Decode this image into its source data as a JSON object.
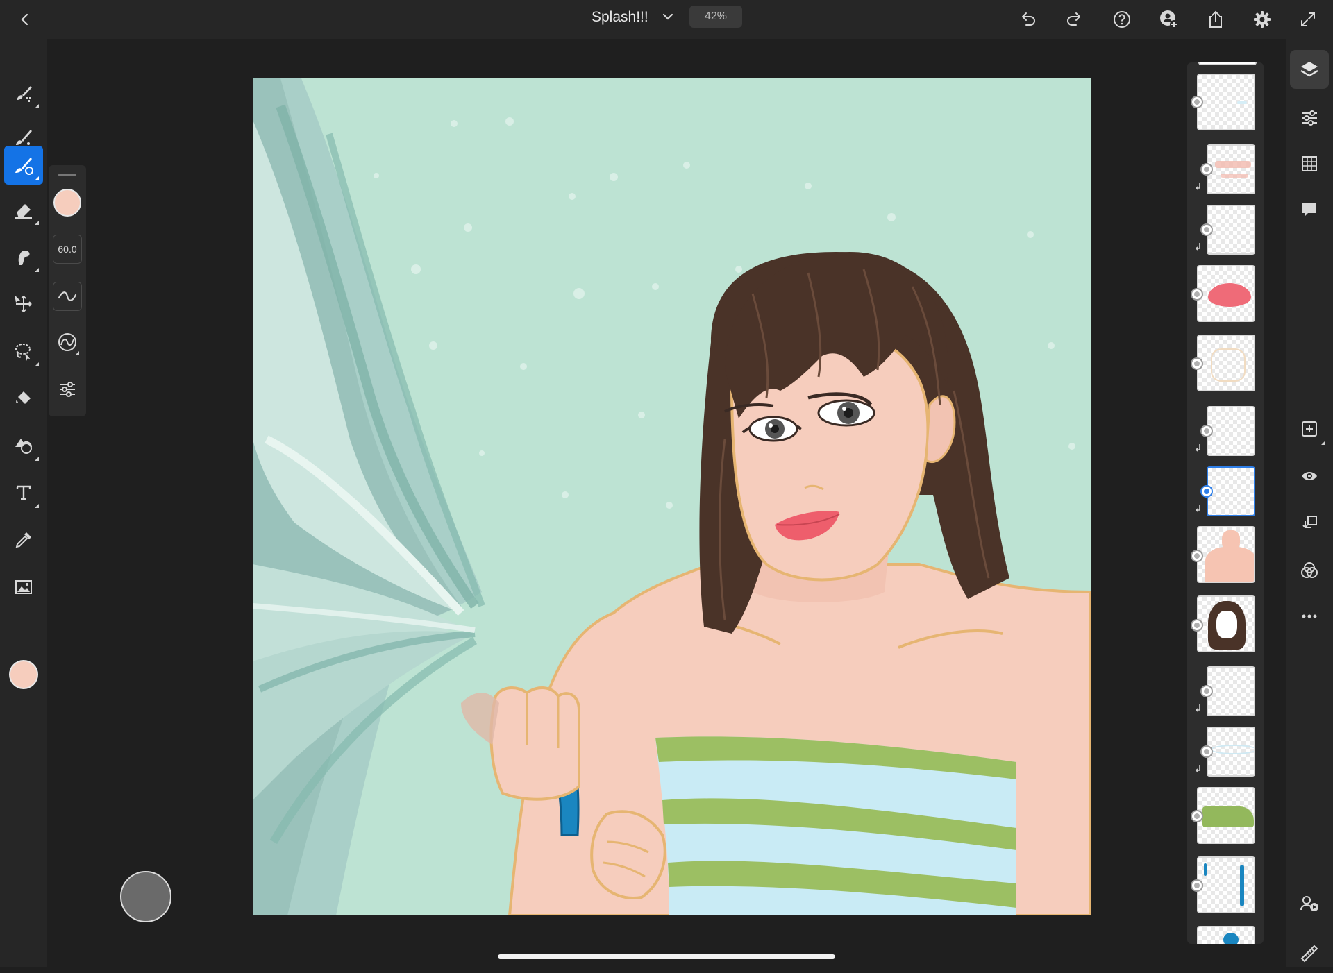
{
  "app": {
    "doc_title": "Splash!!!",
    "zoom": "42%"
  },
  "brush_panel": {
    "size": "60.0",
    "color": "#f6cdbd"
  },
  "left_tools": [
    {
      "name": "pixel-brush",
      "icon": "pixel-brush-icon"
    },
    {
      "name": "live-brush",
      "icon": "live-brush-icon"
    },
    {
      "name": "vector-brush",
      "icon": "vector-brush-icon",
      "active": true
    },
    {
      "name": "eraser",
      "icon": "eraser-icon"
    },
    {
      "name": "smudge",
      "icon": "smudge-icon"
    },
    {
      "name": "transform",
      "icon": "move-icon"
    },
    {
      "name": "selection",
      "icon": "lasso-icon"
    },
    {
      "name": "fill",
      "icon": "paint-bucket-icon"
    },
    {
      "name": "shapes",
      "icon": "shapes-icon"
    },
    {
      "name": "text",
      "icon": "text-icon"
    },
    {
      "name": "eyedropper",
      "icon": "eyedropper-icon"
    },
    {
      "name": "place-image",
      "icon": "image-icon"
    }
  ],
  "right_tools": [
    {
      "name": "layers",
      "icon": "layers-icon",
      "active": true
    },
    {
      "name": "layer-properties",
      "icon": "sliders-icon"
    },
    {
      "name": "grid",
      "icon": "grid-icon"
    },
    {
      "name": "comments",
      "icon": "comment-icon"
    },
    {
      "name": "add-layer",
      "icon": "add-layer-icon"
    },
    {
      "name": "visibility",
      "icon": "eye-icon"
    },
    {
      "name": "clipping-mask",
      "icon": "clip-icon"
    },
    {
      "name": "blend-mode",
      "icon": "blend-icon"
    },
    {
      "name": "more",
      "icon": "more-icon"
    },
    {
      "name": "collaborate",
      "icon": "collaborate-icon"
    },
    {
      "name": "ruler",
      "icon": "ruler-icon"
    }
  ],
  "layers": [
    {
      "content": "blue streak",
      "clipped": false
    },
    {
      "content": "pink blush",
      "clipped": true
    },
    {
      "content": "empty",
      "clipped": true
    },
    {
      "content": "pink lips",
      "clipped": false
    },
    {
      "content": "face outline",
      "clipped": false
    },
    {
      "content": "empty",
      "clipped": true
    },
    {
      "content": "empty",
      "clipped": true,
      "selected": true
    },
    {
      "content": "skin body",
      "clipped": false
    },
    {
      "content": "brown hair",
      "clipped": false
    },
    {
      "content": "empty",
      "clipped": true
    },
    {
      "content": "light blue stripe",
      "clipped": true
    },
    {
      "content": "green towel",
      "clipped": false
    },
    {
      "content": "blue hose",
      "clipped": false
    }
  ],
  "colors": {
    "accent": "#1473e6",
    "canvas_bg": "#bde3d3",
    "skin": "#f6cdbd",
    "hair": "#4a3328",
    "towel_green": "#9cbf63",
    "towel_blue": "#c9ebf5",
    "hose": "#1a86c0",
    "lips": "#ee5e6c"
  }
}
